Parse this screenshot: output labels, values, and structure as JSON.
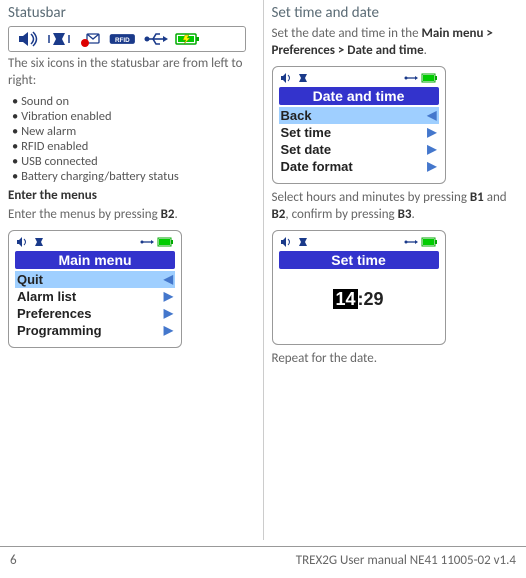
{
  "left": {
    "heading": "Statusbar",
    "intro": "The six icons in the statusbar are from left to right:",
    "icons": [
      "Sound on",
      "Vibration enabled",
      "New alarm",
      "RFID enabled",
      "USB connected",
      "Battery charging/battery status"
    ],
    "enter_head": "Enter the menus",
    "enter_text_a": "Enter the menus by pressing ",
    "enter_text_b": "B2",
    "enter_text_c": ".",
    "screen1": {
      "title": "Main menu",
      "rows": [
        {
          "label": "Quit",
          "dir": "left",
          "sel": true
        },
        {
          "label": "Alarm list",
          "dir": "right"
        },
        {
          "label": "Preferences",
          "dir": "right"
        },
        {
          "label": "Programming",
          "dir": "right"
        }
      ]
    }
  },
  "right": {
    "heading": "Set time and date",
    "p1a": "Set the date and time in the ",
    "p1b": "Main menu > Preferences > Date and time",
    "p1c": ".",
    "screen2": {
      "title": "Date and time",
      "rows": [
        {
          "label": "Back",
          "dir": "left",
          "sel": true
        },
        {
          "label": "Set time",
          "dir": "right"
        },
        {
          "label": "Set date",
          "dir": "right"
        },
        {
          "label": "Date format",
          "dir": "right"
        }
      ]
    },
    "p2a": "Select hours and minutes by pressing ",
    "p2b": "B1",
    "p2c": " and ",
    "p2d": "B2",
    "p2e": ", confirm by pressing ",
    "p2f": "B3",
    "p2g": ".",
    "screen3": {
      "title": "Set time",
      "hours": "14",
      "sep": ":",
      "mins": "29"
    },
    "p3": "Repeat for the date."
  },
  "footer": {
    "page": "6",
    "doc": "TREX2G User manual NE41 11005-02 v1.4"
  }
}
